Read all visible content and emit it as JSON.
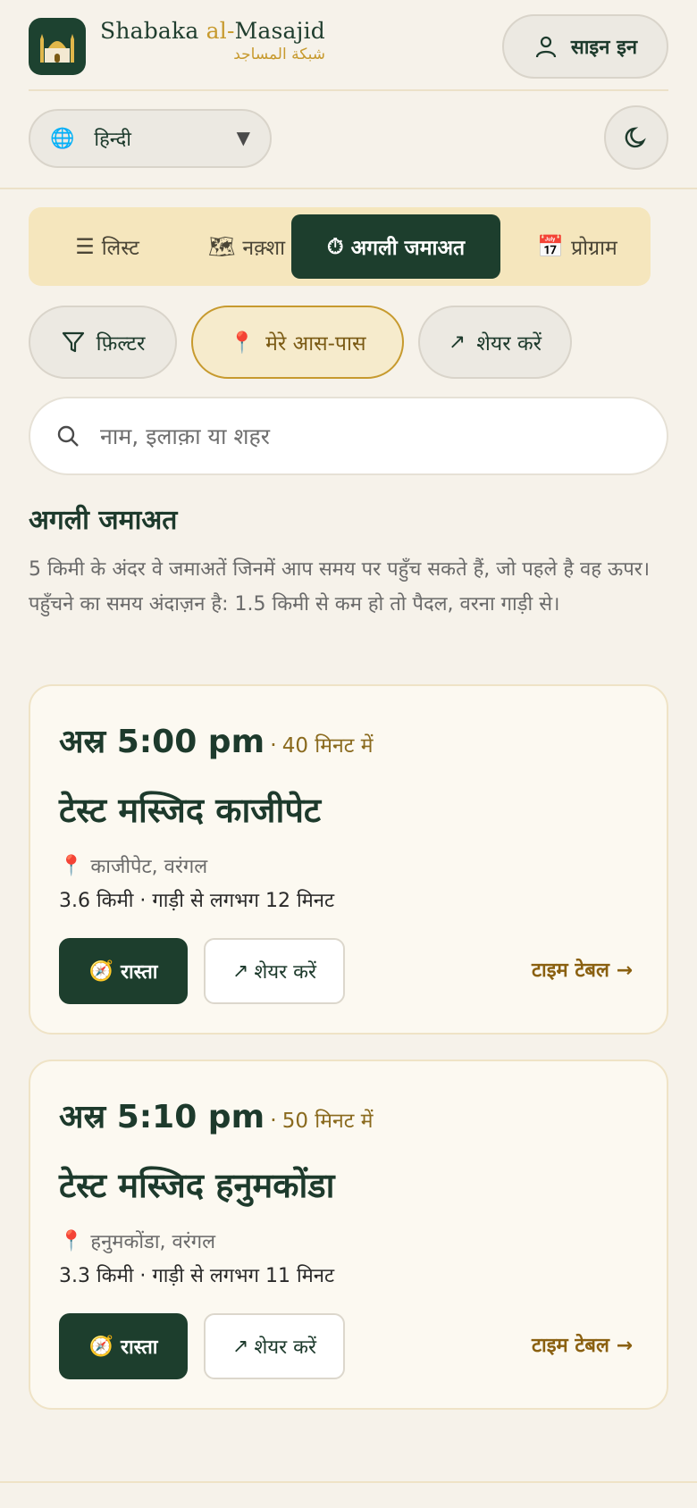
{
  "header": {
    "brand_name_part1": "Shabaka ",
    "brand_name_part2": "al-",
    "brand_name_part3": "Masajid",
    "brand_arabic": "شبكة المساجد",
    "logo_icon": "mosque-icon",
    "signin_label": "साइन इन"
  },
  "language": {
    "selected": "हिन्दी",
    "icon": "globe-icon"
  },
  "tabs": [
    {
      "label": "लिस्ट",
      "icon": "☰"
    },
    {
      "label": "नक़्शा",
      "icon": "🗺"
    },
    {
      "label": "अगली जमाअत",
      "icon": "⏱"
    },
    {
      "label": "प्रोग्राम",
      "icon": "📅"
    }
  ],
  "chips": {
    "filter_label": "फ़िल्टर",
    "nearby_label": "मेरे आस-पास",
    "share_label": "शेयर करें"
  },
  "search": {
    "placeholder": "नाम, इलाक़ा या शहर"
  },
  "section": {
    "title": "अगली जमाअत",
    "description": "5 किमी के अंदर वे जमाअतें जिनमें आप समय पर पहुँच सकते हैं, जो पहले है वह ऊपर। पहुँचने का समय अंदाज़न है: 1.5 किमी से कम हो तो पैदल, वरना गाड़ी से।"
  },
  "cards": [
    {
      "time": "अस्र 5:00 pm",
      "relative": "40 मिनट में",
      "name": "टेस्ट मस्जिद काजीपेट",
      "location": "काजीपेट, वरंगल",
      "distance": "3.6 किमी · गाड़ी से लगभग 12 मिनट",
      "route_label": "रास्ता",
      "share_label": "शेयर करें",
      "timetable_label": "टाइम टेबल →"
    },
    {
      "time": "अस्र 5:10 pm",
      "relative": "50 मिनट में",
      "name": "टेस्ट मस्जिद हनुमकोंडा",
      "location": "हनुमकोंडा, वरंगल",
      "distance": "3.3 किमी · गाड़ी से लगभग 11 मिनट",
      "route_label": "रास्ता",
      "share_label": "शेयर करें",
      "timetable_label": "टाइम टेबल →"
    }
  ],
  "colors": {
    "primary": "#1d3e2d",
    "accent": "#c79a2e",
    "background": "#f6f2ea",
    "tab_bar": "#f5e6bd"
  }
}
